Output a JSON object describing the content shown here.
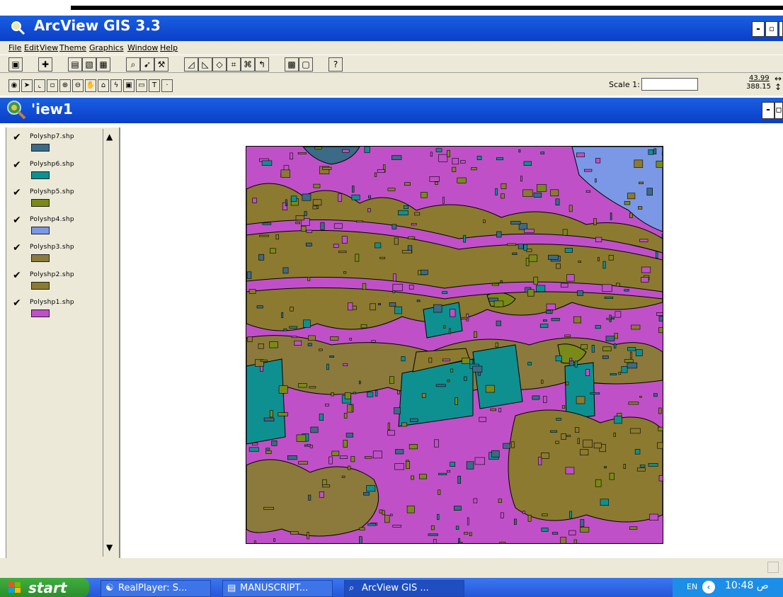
{
  "window": {
    "title": "ArcView GIS 3.3",
    "buttons": {
      "minimize": "-",
      "restore": "▫",
      "close": "x"
    }
  },
  "menu": [
    "File",
    "Edit",
    "View",
    "Theme",
    "Graphics",
    "Window",
    "Help"
  ],
  "toolbar2": {
    "scale_label": "Scale 1:",
    "scale_value": "",
    "coord_x": "43.99",
    "coord_y": "388.15"
  },
  "view": {
    "title": "'iew1",
    "buttons": {
      "minimize": "-",
      "restore": "▫",
      "close": "X"
    }
  },
  "layers": [
    {
      "label": "Polyshp7.shp",
      "color": "#3b6b86",
      "checked": true
    },
    {
      "label": "Polyshp6.shp",
      "color": "#0f9090",
      "checked": true
    },
    {
      "label": "Polyshp5.shp",
      "color": "#7a8a18",
      "checked": true
    },
    {
      "label": "Polyshp4.shp",
      "color": "#7a98e6",
      "checked": true
    },
    {
      "label": "Polyshp3.shp",
      "color": "#8c7a3c",
      "checked": true
    },
    {
      "label": "Polyshp2.shp",
      "color": "#8c7a30",
      "checked": true
    },
    {
      "label": "Polyshp1.shp",
      "color": "#c050c8",
      "checked": true
    }
  ],
  "taskbar": {
    "start": "start",
    "tasks": [
      "RealPlayer: S...",
      "MANUSCRIPT...",
      "ArcView GIS ..."
    ],
    "lang": "EN",
    "time": "10:48 ص"
  }
}
